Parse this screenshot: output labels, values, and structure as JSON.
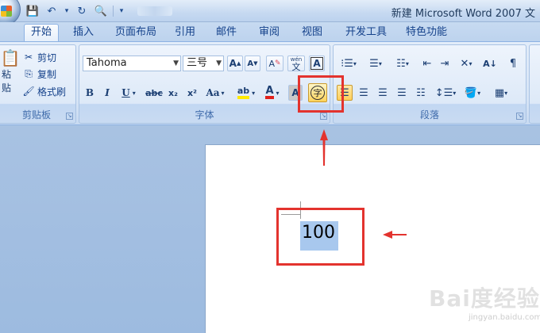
{
  "title_bar": {
    "title": "新建 Microsoft Word 2007 文",
    "qat": [
      {
        "name": "save-icon",
        "glyph": "🖫"
      },
      {
        "name": "undo-icon",
        "glyph": "↶"
      },
      {
        "name": "dropdown-icon",
        "glyph": "▾"
      },
      {
        "name": "redo-icon",
        "glyph": "↻"
      },
      {
        "name": "print-preview-icon",
        "glyph": "🔍"
      },
      {
        "name": "qat-customize-icon",
        "glyph": "▾"
      }
    ]
  },
  "tabs": [
    "开始",
    "插入",
    "页面布局",
    "引用",
    "邮件",
    "审阅",
    "视图",
    "开发工具",
    "特色功能"
  ],
  "active_tab": "开始",
  "clipboard": {
    "paste_label": "粘贴",
    "cut_label": "剪切",
    "copy_label": "复制",
    "format_painter_label": "格式刷",
    "group_label": "剪贴板"
  },
  "font": {
    "font_name": "Tahoma",
    "font_size": "三号",
    "group_label": "字体",
    "grow_label": "A",
    "shrink_label": "A",
    "clear_format_label": "A",
    "phonetic_label": "文",
    "char_border_label": "A",
    "bold_label": "B",
    "italic_label": "I",
    "underline_label": "U",
    "strike_label": "abc",
    "subscript_label": "x₂",
    "superscript_label": "x²",
    "change_case_label": "Aa",
    "highlight_label": "ab",
    "font_color_label": "A",
    "char_shading_label": "A",
    "enclose_char_label": "字"
  },
  "paragraph": {
    "group_label": "段落"
  },
  "document": {
    "selected_text": "100"
  },
  "watermark": {
    "text": "Bai度经验",
    "url": "jingyan.baidu.com"
  },
  "colors": {
    "annotation_red": "#e3332e",
    "selection_blue": "#a8c8ee",
    "ribbon_blue": "#dde9f8"
  }
}
